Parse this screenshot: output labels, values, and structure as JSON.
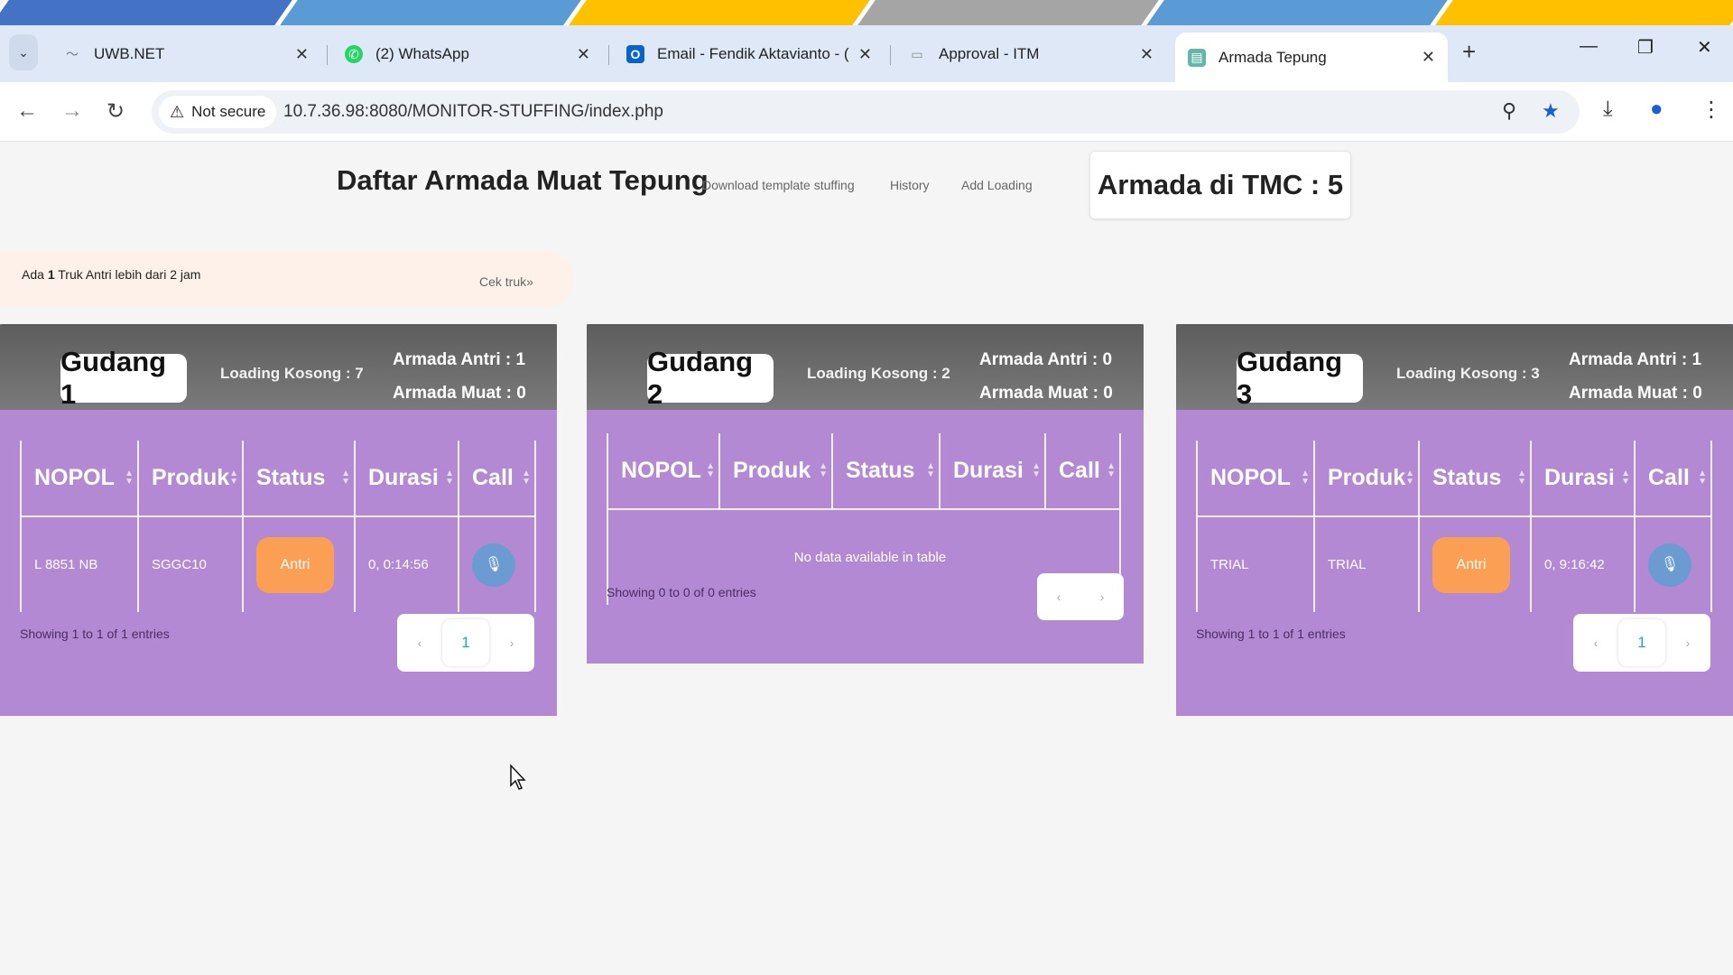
{
  "browser": {
    "tabs": [
      {
        "title": "UWB.NET",
        "favicon_color": "#6b7b8c"
      },
      {
        "title": "(2) WhatsApp",
        "favicon_color": "#25d366"
      },
      {
        "title": "Email - Fendik Aktavianto - (",
        "favicon_color": "#0a64c8"
      },
      {
        "title": "Approval - ITM",
        "favicon_color": "#8a8a8a"
      },
      {
        "title": "Armada Tepung",
        "favicon_color": "#62b7a8"
      }
    ],
    "active_tab_index": 4,
    "security_label": "Not secure",
    "url": "10.7.36.98:8080/MONITOR-STUFFING/index.php"
  },
  "header": {
    "title": "Daftar Armada Muat Tepung",
    "links": [
      "Download template stuffing",
      "History",
      "Add Loading"
    ],
    "tmc_label": "Armada di TMC : 5"
  },
  "alert": {
    "prefix": "Ada ",
    "count": "1",
    "suffix": " Truk Antri lebih dari 2 jam",
    "link": "Cek truk»"
  },
  "columns": [
    "NOPOL",
    "Produk",
    "Status",
    "Durasi",
    "Call"
  ],
  "gudang": [
    {
      "name": "Gudang 1",
      "loading_kosong": "Loading Kosong : 7",
      "armada_antri": "Armada Antri : 1",
      "armada_muat": "Armada Muat : 0",
      "rows": [
        {
          "nopol": "L 8851 NB",
          "produk": "SGGC10",
          "status": "Antri",
          "durasi": "0, 0:14:56"
        }
      ],
      "showing": "Showing 1 to 1 of 1 entries",
      "page": "1"
    },
    {
      "name": "Gudang 2",
      "loading_kosong": "Loading Kosong : 2",
      "armada_antri": "Armada Antri : 0",
      "armada_muat": "Armada Muat : 0",
      "rows": [],
      "empty_text": "No data available in table",
      "showing": "Showing 0 to 0 of 0 entries"
    },
    {
      "name": "Gudang 3",
      "loading_kosong": "Loading Kosong : 3",
      "armada_antri": "Armada Antri : 1",
      "armada_muat": "Armada Muat : 0",
      "rows": [
        {
          "nopol": "TRIAL",
          "produk": "TRIAL",
          "status": "Antri",
          "durasi": "0, 9:16:42"
        }
      ],
      "showing": "Showing 1 to 1 of 1 entries",
      "page": "1"
    }
  ],
  "colors": {
    "panel_bg": "#b489d4",
    "status_antri": "#fb9f55",
    "call_button": "#6c9bd2",
    "stripe": [
      "#4472c4",
      "#5b9bd5",
      "#ffc000",
      "#a5a5a5",
      "#5b9bd5",
      "#ffc000"
    ]
  }
}
